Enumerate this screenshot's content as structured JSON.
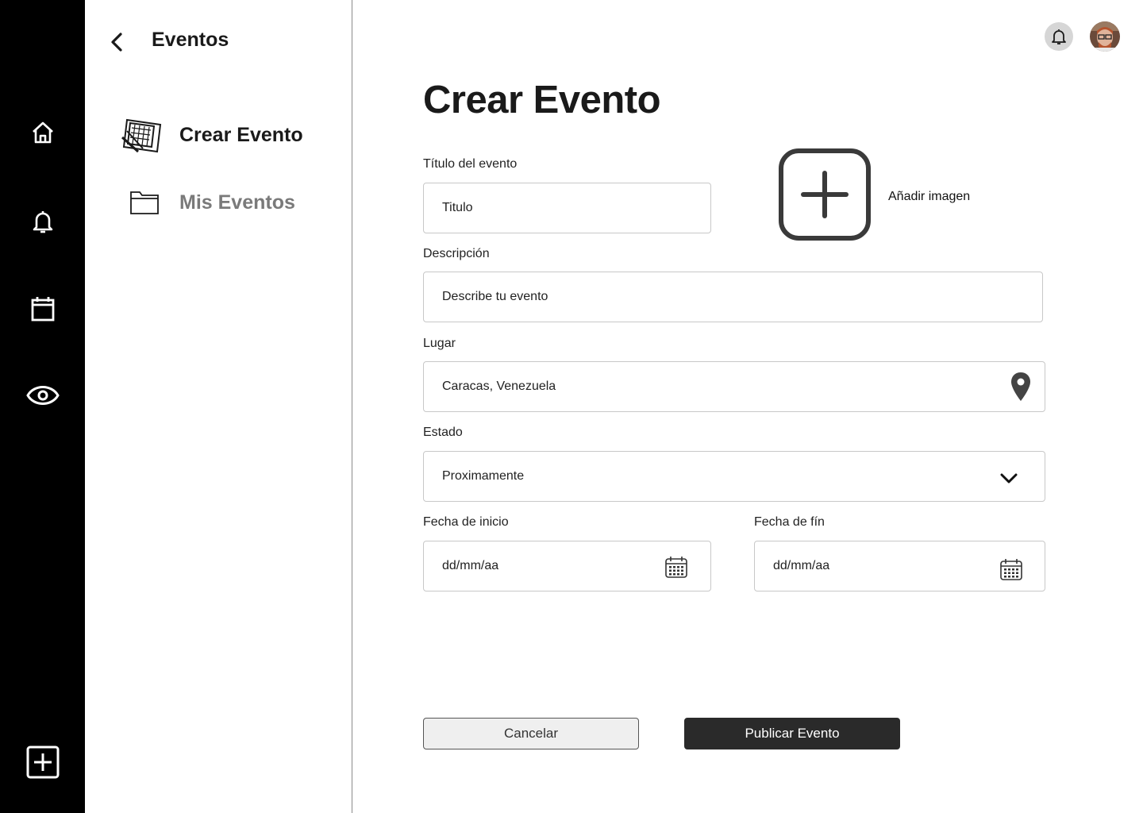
{
  "sidebar": {
    "title": "Eventos",
    "items": [
      {
        "label": "Crear Evento",
        "active": true,
        "icon": "create-event-icon",
        "color": "#1a1a1a"
      },
      {
        "label": "Mis Eventos",
        "active": false,
        "icon": "folder-icon",
        "color": "#7a7a7a"
      }
    ]
  },
  "rail": {
    "items": [
      "home-icon",
      "bell-icon",
      "calendar-icon",
      "eye-icon"
    ],
    "bottom": "add-square-icon"
  },
  "header": {
    "icons": [
      "notification-bell-icon",
      "user-avatar"
    ]
  },
  "form": {
    "title": "Crear Evento",
    "titulo": {
      "label": "Título del evento",
      "placeholder": "Titulo"
    },
    "descripcion": {
      "label": "Descripción",
      "placeholder": "Describe tu evento"
    },
    "lugar": {
      "label": "Lugar",
      "value": "Caracas, Venezuela"
    },
    "estado": {
      "label": "Estado",
      "value": "Proximamente"
    },
    "fecha_inicio": {
      "label": "Fecha de inicio",
      "placeholder": "dd/mm/aa"
    },
    "fecha_fin": {
      "label": "Fecha de fín",
      "placeholder": "dd/mm/aa"
    },
    "add_image_label": "Añadir imagen"
  },
  "actions": {
    "cancel": "Cancelar",
    "publish": "Publicar Evento"
  },
  "colors": {
    "rail_bg": "#000000",
    "primary_button": "#2a2a2a",
    "secondary_button": "#efefef"
  }
}
